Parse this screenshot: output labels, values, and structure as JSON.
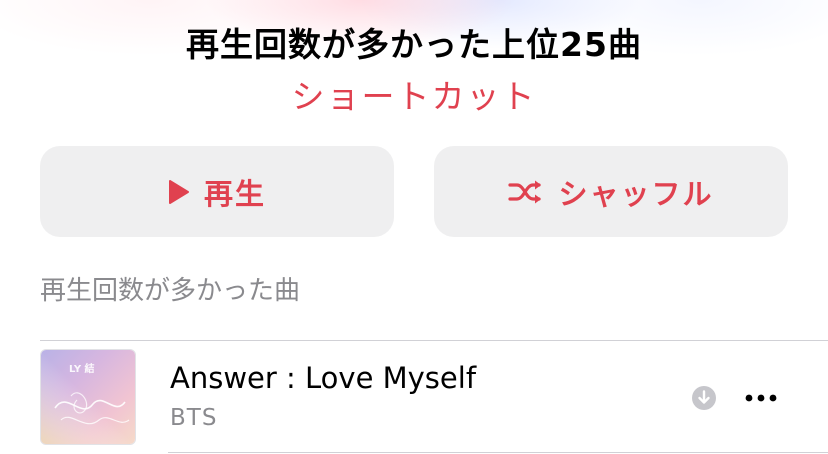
{
  "header": {
    "title": "再生回数が多かった上位25曲",
    "subtitle": "ショートカット"
  },
  "actions": {
    "play_label": "再生",
    "shuffle_label": "シャッフル"
  },
  "section": {
    "header": "再生回数が多かった曲"
  },
  "tracks": [
    {
      "title": "Answer : Love Myself",
      "artist": "BTS",
      "artwork_text": "LY 結",
      "downloaded": true
    }
  ],
  "icons": {
    "play": "play-icon",
    "shuffle": "shuffle-icon",
    "download": "download-icon",
    "more": "more-icon"
  },
  "colors": {
    "accent": "#e0414f",
    "button_bg": "#efeff0",
    "secondary_text": "#8a8a8e",
    "divider": "#d1d1d6"
  }
}
